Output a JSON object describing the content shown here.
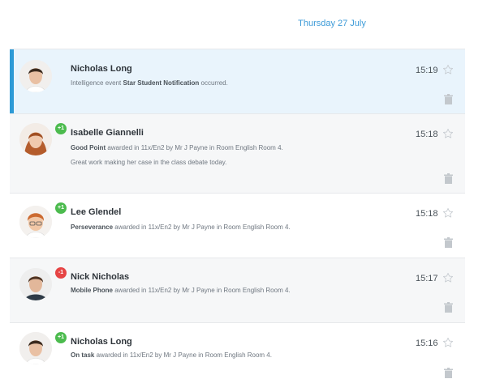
{
  "date_header": "Thursday 27 July",
  "events": [
    {
      "name": "Nicholas Long",
      "badge": "",
      "type": "highlight",
      "line_prefix": "Intelligence event ",
      "line_bold": "Star Student Notification",
      "line_suffix": " occurred.",
      "comment": "",
      "time": "15:19"
    },
    {
      "name": "Isabelle Giannelli",
      "badge": "+1",
      "type": "grey",
      "line_prefix": "",
      "line_bold": "Good Point",
      "line_suffix": " awarded in 11x/En2 by Mr J Payne in Room English Room 4.",
      "comment": "Great work making her case in the class debate today.",
      "time": "15:18"
    },
    {
      "name": "Lee Glendel",
      "badge": "+1",
      "type": "white",
      "line_prefix": "",
      "line_bold": "Perseverance",
      "line_suffix": " awarded in 11x/En2 by Mr J Payne in Room English Room 4.",
      "comment": "",
      "time": "15:18"
    },
    {
      "name": "Nick Nicholas",
      "badge": "-1",
      "type": "grey",
      "line_prefix": "",
      "line_bold": "Mobile Phone",
      "line_suffix": " awarded in 11x/En2 by Mr J Payne in Room English Room 4.",
      "comment": "",
      "time": "15:17"
    },
    {
      "name": "Nicholas Long",
      "badge": "+1",
      "type": "white",
      "line_prefix": "",
      "line_bold": "On task",
      "line_suffix": " awarded in 11x/En2 by Mr J Payne in Room English Room 4.",
      "comment": "",
      "time": "15:16"
    }
  ],
  "icons": {
    "star": "star-outline-icon",
    "delete": "trash-icon"
  },
  "colors": {
    "accent": "#2d9ad6",
    "highlight_bg": "#e9f4fc",
    "positive_badge": "#4cbb4e",
    "negative_badge": "#e64545",
    "date_text": "#3d9bd8"
  }
}
